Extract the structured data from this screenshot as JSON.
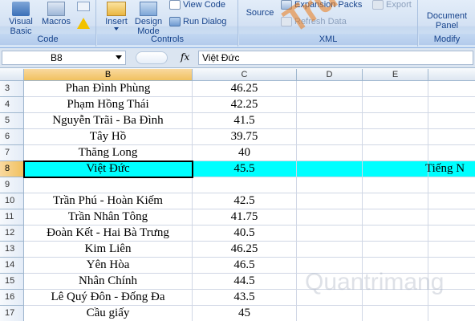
{
  "ribbon": {
    "code_group": {
      "label": "Code",
      "visual_basic": "Visual\nBasic",
      "macros": "Macros"
    },
    "controls_group": {
      "label": "Controls",
      "insert": "Insert",
      "design_mode": "Design\nMode",
      "view_code": "View Code",
      "run_dialog": "Run Dialog"
    },
    "xml_group": {
      "label": "XML",
      "source": "Source",
      "expansion_packs": "Expansion Packs",
      "export": "Export",
      "refresh_data": "Refresh Data"
    },
    "modify_group": {
      "label": "Modify",
      "document_panel": "Document\nPanel"
    }
  },
  "formula_bar": {
    "name_box": "B8",
    "fx": "fx",
    "value": "Việt Đức"
  },
  "columns": [
    "B",
    "C",
    "D",
    "E"
  ],
  "rows": [
    {
      "num": "3",
      "b": "Phan Đình Phùng",
      "c": "46.25"
    },
    {
      "num": "4",
      "b": "Phạm Hồng Thái",
      "c": "42.25"
    },
    {
      "num": "5",
      "b": "Nguyễn Trãi - Ba Đình",
      "c": "41.5"
    },
    {
      "num": "6",
      "b": "Tây Hồ",
      "c": "39.75"
    },
    {
      "num": "7",
      "b": "Thăng Long",
      "c": "40"
    },
    {
      "num": "8",
      "b": "Việt Đức",
      "c": "45.5",
      "overflow": "Tiếng N"
    },
    {
      "num": "9",
      "b": "",
      "c": ""
    },
    {
      "num": "10",
      "b": "Trần Phú - Hoàn Kiếm",
      "c": "42.5"
    },
    {
      "num": "11",
      "b": "Trần Nhân Tông",
      "c": "41.75"
    },
    {
      "num": "12",
      "b": "Đoàn Kết - Hai Bà Trưng",
      "c": "40.5"
    },
    {
      "num": "13",
      "b": "Kim Liên",
      "c": "46.25"
    },
    {
      "num": "14",
      "b": "Yên Hòa",
      "c": "46.5"
    },
    {
      "num": "15",
      "b": "Nhân Chính",
      "c": "44.5"
    },
    {
      "num": "16",
      "b": "Lê Quý Đôn - Đống Đa",
      "c": "43.5"
    },
    {
      "num": "17",
      "b": "Cầu giấy",
      "c": "45"
    }
  ],
  "selected_row": "8",
  "highlight_color": "#00ffff",
  "watermark": {
    "main": "Truongtin.top",
    "secondary": "Quantrimang"
  }
}
